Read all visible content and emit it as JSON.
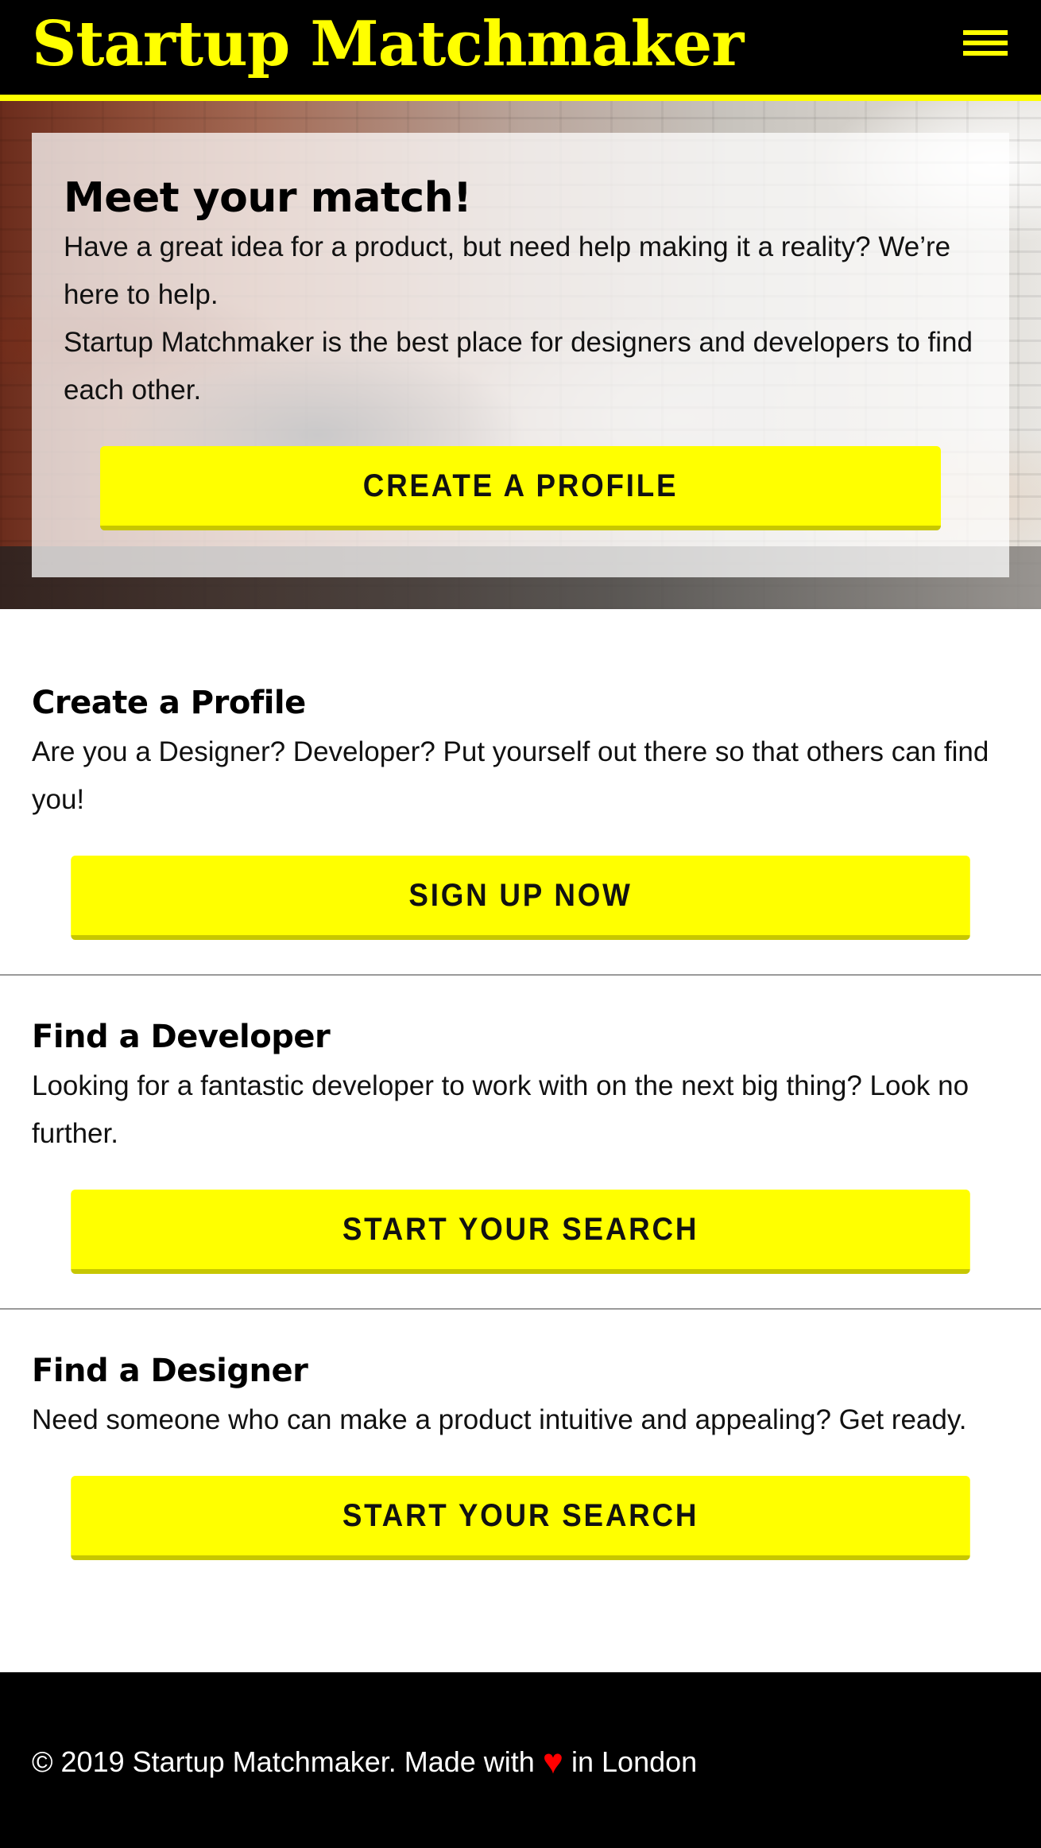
{
  "header": {
    "brand": "Startup Matchmaker",
    "menu_icon": "hamburger-menu-icon"
  },
  "hero": {
    "title": "Meet your match!",
    "paragraphs": [
      "Have a great idea for a product, but need help making it a reality? We’re here to help.",
      "Startup Matchmaker is the best place for designers and developers to find each other."
    ],
    "button_label": "CREATE A PROFILE"
  },
  "sections": [
    {
      "title": "Create a Profile",
      "text": "Are you a Designer? Developer? Put yourself out there so that others can find you!",
      "button_label": "SIGN UP NOW"
    },
    {
      "title": "Find a Developer",
      "text": "Looking for a fantastic developer to work with on the next big thing? Look no further.",
      "button_label": "START YOUR SEARCH"
    },
    {
      "title": "Find a Designer",
      "text": "Need someone who can make a product intuitive and appealing? Get ready.",
      "button_label": "START YOUR SEARCH"
    }
  ],
  "footer": {
    "text_before": "© 2019 Startup Matchmaker. Made with",
    "heart_icon": "heart-icon",
    "heart_glyph": "♥",
    "text_after": "in London"
  },
  "colors": {
    "accent": "#ffff00",
    "header_bg": "#000000",
    "footer_bg": "#000000",
    "heart": "#ff0000"
  }
}
